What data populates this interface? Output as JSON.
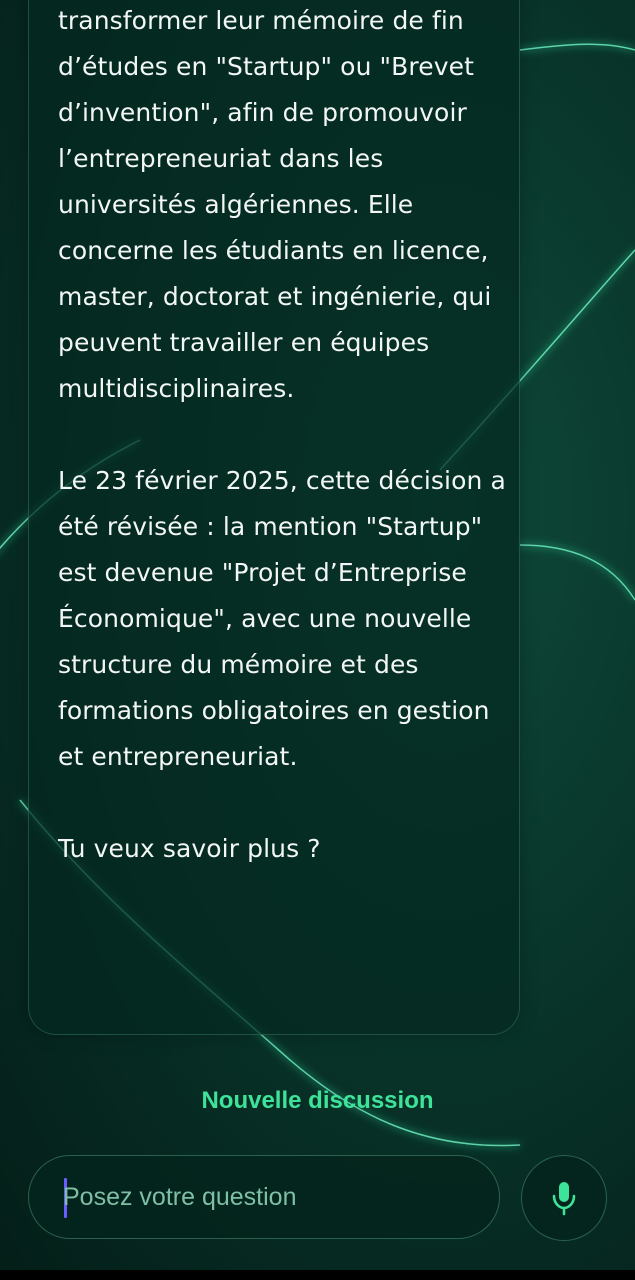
{
  "message": {
    "paragraphs": [
      "transformer leur mémoire de fin d’études en \"Startup\" ou \"Brevet d’invention\", afin de promouvoir l’entrepreneuriat dans les universités algériennes. Elle concerne les étudiants en licence, master, doctorat et ingénierie, qui peuvent travailler en équipes multidisciplinaires.",
      "Le 23 février 2025, cette décision a été révisée : la mention \"Startup\" est devenue \"Projet d’Entreprise Économique\", avec une nouvelle structure du mémoire et des formations obligatoires en gestion et entrepreneuriat.",
      "Tu veux savoir plus ?"
    ]
  },
  "actions": {
    "new_chat_label": "Nouvelle discussion"
  },
  "composer": {
    "placeholder": "Posez votre question",
    "value": "",
    "mic_icon": "microphone-icon"
  },
  "colors": {
    "accent": "#3ee39a",
    "background": "#0a3a2e",
    "caret": "#6b5cff"
  }
}
